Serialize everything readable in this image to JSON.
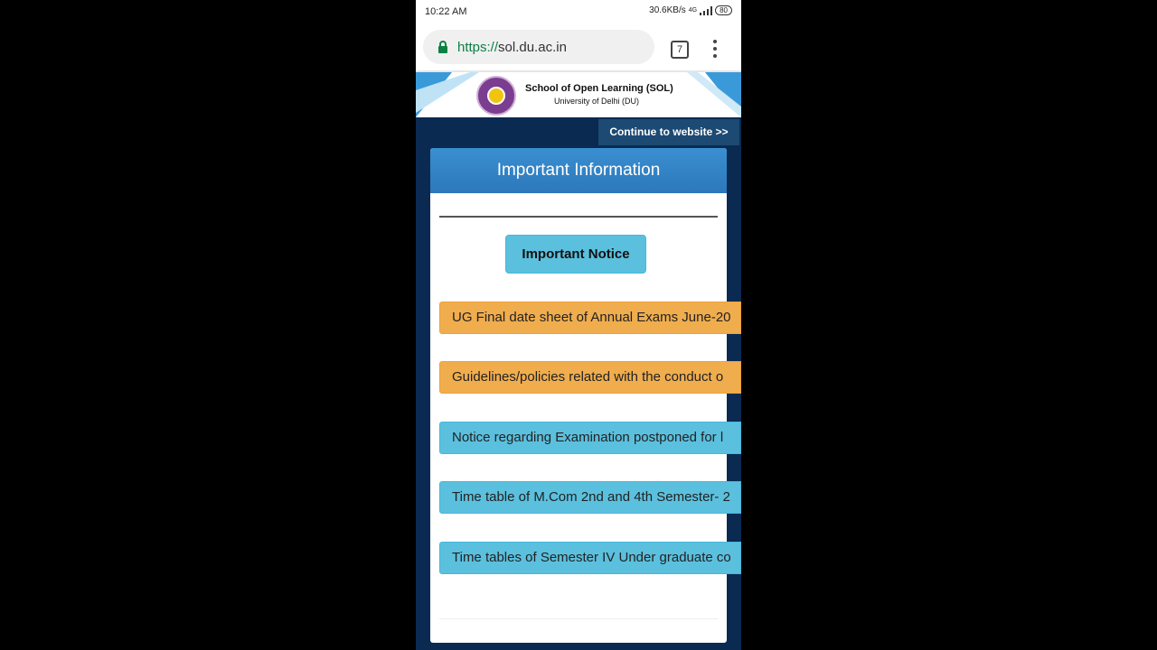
{
  "status": {
    "time": "10:22 AM",
    "speed": "30.6KB/s",
    "network": "4G",
    "battery": "80"
  },
  "browser": {
    "url_scheme": "https://",
    "url_host": "sol.du.ac.in",
    "tab_count": "7"
  },
  "header": {
    "title": "School of Open Learning (SOL)",
    "subtitle": "University of Delhi (DU)"
  },
  "continue_label": "Continue to website >>",
  "panel": {
    "title": "Important Information",
    "notice_button": "Important Notice",
    "notices": [
      {
        "text": "UG Final date sheet of Annual Exams June-20",
        "style": "warning"
      },
      {
        "text": "Guidelines/policies related with the conduct o",
        "style": "warning"
      },
      {
        "text": "Notice regarding Examination postponed for l",
        "style": "info"
      },
      {
        "text": "Time table of M.Com 2nd and 4th Semester- 2",
        "style": "info"
      },
      {
        "text": "Time tables of Semester IV Under graduate co",
        "style": "info"
      }
    ]
  },
  "colors": {
    "warning": "#f0ad4e",
    "info": "#5bc0de",
    "header": "#2c78bb",
    "page_bg": "#0a2a52"
  }
}
